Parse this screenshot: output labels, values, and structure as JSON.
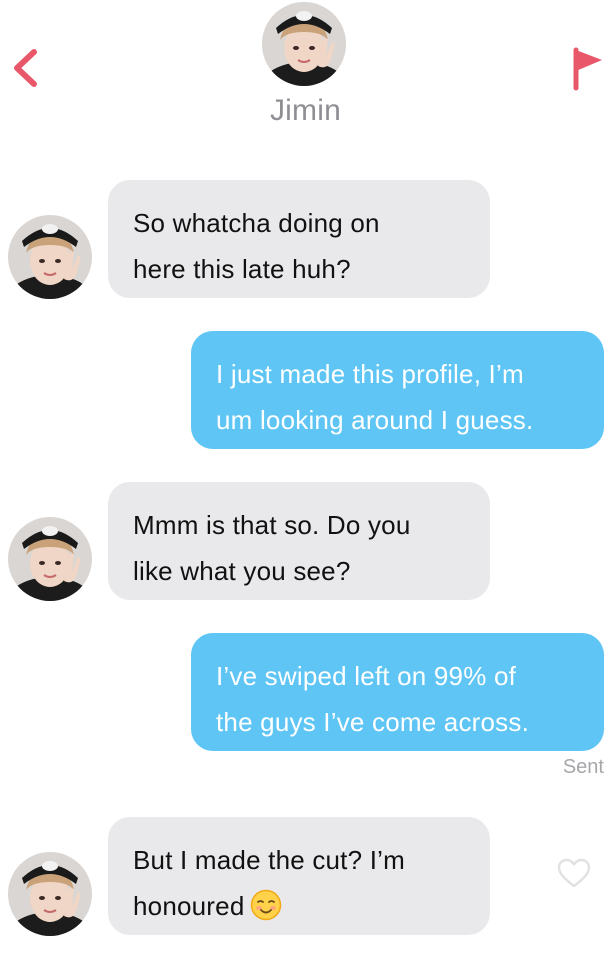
{
  "header": {
    "contact_name": "Jimin",
    "back_icon": "chevron-left-icon",
    "report_icon": "flag-icon"
  },
  "colors": {
    "accent": "#e9576a",
    "incoming_bubble": "#e9e9eb",
    "outgoing_bubble": "#5ec5f5",
    "name_text": "#8e8e93",
    "status_text": "#a7a7ab"
  },
  "messages": [
    {
      "direction": "incoming",
      "lines": [
        "So whatcha doing on",
        "here this late huh?"
      ]
    },
    {
      "direction": "outgoing",
      "lines": [
        "I just made this profile, I’m",
        "um looking around I guess."
      ]
    },
    {
      "direction": "incoming",
      "lines": [
        "Mmm is that so. Do you",
        "like what you see?"
      ]
    },
    {
      "direction": "outgoing",
      "lines": [
        "I’ve swiped left on 99% of",
        "the guys I’ve come across."
      ]
    },
    {
      "direction": "incoming",
      "lines": [
        "But I made the cut? I’m",
        "honoured"
      ],
      "emoji": "smiling-face-with-blush-emoji"
    }
  ],
  "status": {
    "sent_label": "Sent"
  },
  "like_icon": "heart-outline-icon"
}
